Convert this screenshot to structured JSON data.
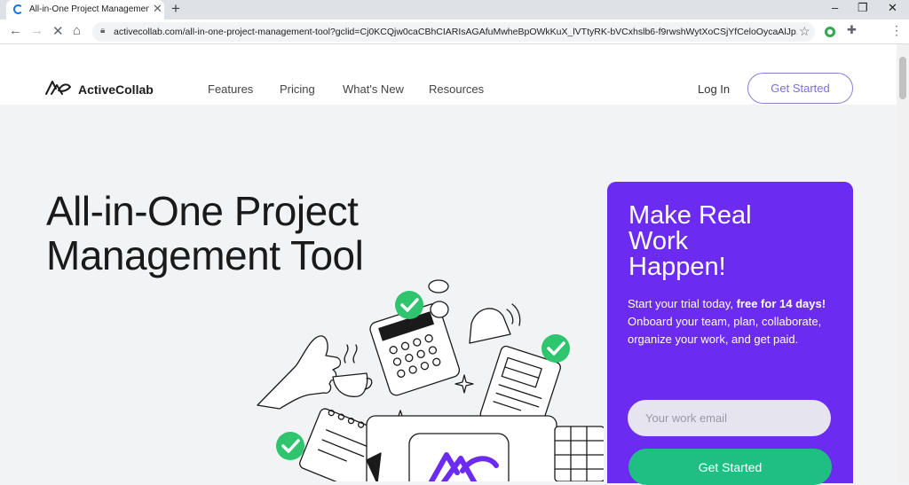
{
  "browser": {
    "tab_title": "All-in-One Project Management",
    "tab_close": "✕",
    "new_tab": "+",
    "url": "activecollab.com/all-in-one-project-management-tool?gclid=Cj0KCQjw0caCBhCIARIsAGAfuMwheBpOWkKuX_lVTtyRK-bVCxhslb6-f9rwshWytXoCSjYfCeloOycaAlJp...",
    "window_controls": [
      "–",
      "❐",
      "✕"
    ]
  },
  "header": {
    "logo_text": "ActiveCollab",
    "nav": [
      "Features",
      "Pricing",
      "What's New",
      "Resources"
    ],
    "login": "Log In",
    "get_started": "Get Started"
  },
  "hero": {
    "title_line1": "All-in-One Project",
    "title_line2": "Management Tool"
  },
  "card": {
    "title_line1": "Make Real",
    "title_line2": "Work",
    "title_line3": "Happen!",
    "text_before": "Start your trial today, ",
    "text_bold": "free for 14 days!",
    "text_after": " Onboard your team, plan, collaborate, organize your work, and get paid.",
    "email_placeholder": "Your work email",
    "button": "Get Started"
  },
  "colors": {
    "accent_purple": "#6c2bf0",
    "cta_green": "#1fbf84",
    "check_green": "#2fc46e"
  }
}
